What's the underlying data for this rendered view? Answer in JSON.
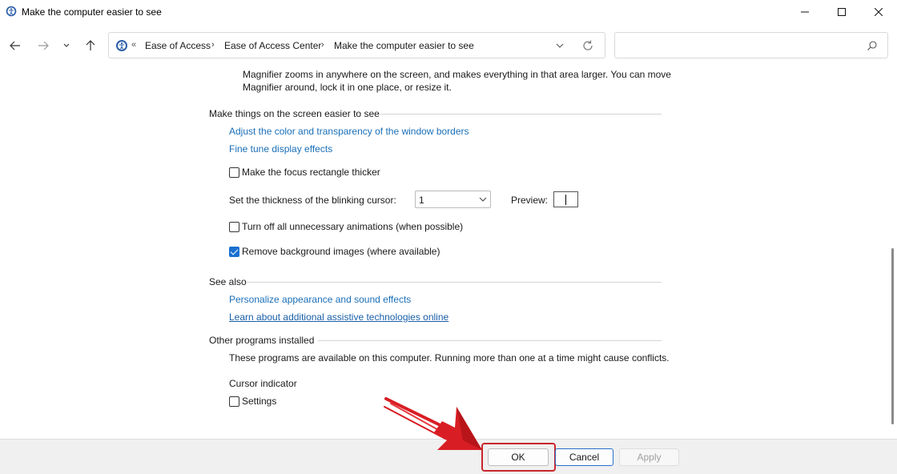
{
  "window": {
    "title": "Make the computer easier to see"
  },
  "breadcrumb": {
    "overflow": "«",
    "items": [
      "Ease of Access",
      "Ease of Access Center",
      "Make the computer easier to see"
    ],
    "separator": "›"
  },
  "search": {
    "placeholder": "",
    "value": ""
  },
  "magnifier": {
    "description": "Magnifier zooms in anywhere on the screen, and makes everything in that area larger. You can move Magnifier around, lock it in one place, or resize it."
  },
  "screen_section": {
    "title": "Make things on the screen easier to see",
    "link_borders": "Adjust the color and transparency of the window borders",
    "link_display": "Fine tune display effects",
    "focus_rect_label": "Make the focus rectangle thicker",
    "focus_rect_checked": false,
    "cursor_label": "Set the thickness of the blinking cursor:",
    "cursor_value": "1",
    "preview_label": "Preview:",
    "animations_label": "Turn off all unnecessary animations (when possible)",
    "animations_checked": false,
    "background_label": "Remove background images (where available)",
    "background_checked": true
  },
  "see_also": {
    "title": "See also",
    "link_personalize": "Personalize appearance and sound effects",
    "link_learn": "Learn about additional assistive technologies online"
  },
  "other_programs": {
    "title": "Other programs installed",
    "description": "These programs are available on this computer. Running more than one at a time might cause conflicts.",
    "cursor_indicator_label": "Cursor indicator",
    "settings_label": "Settings",
    "settings_checked": false
  },
  "footer": {
    "ok_label": "OK",
    "cancel_label": "Cancel",
    "apply_label": "Apply"
  },
  "colors": {
    "link": "#1a6fb8",
    "checkbox_accent": "#1a6fd0",
    "highlight": "#c9272c"
  }
}
